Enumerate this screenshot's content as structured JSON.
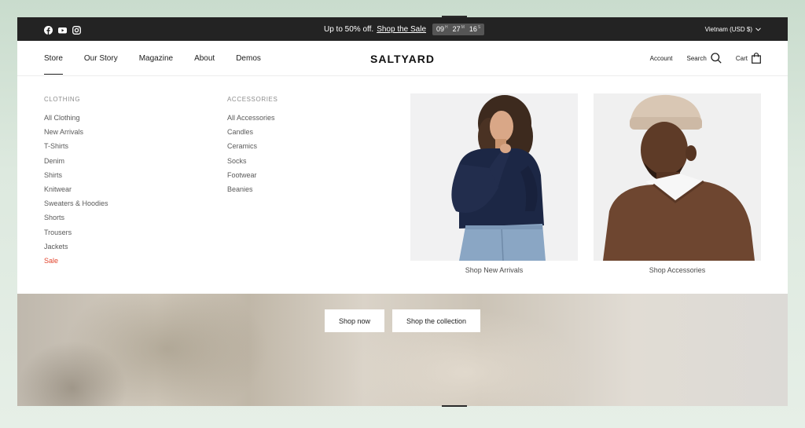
{
  "announcement": {
    "social_icons": [
      "facebook-icon",
      "youtube-icon",
      "instagram-icon"
    ],
    "promo_text": "Up to 50% off.",
    "promo_link": "Shop the Sale",
    "countdown": [
      {
        "value": "09",
        "unit": "H"
      },
      {
        "value": "27",
        "unit": "M"
      },
      {
        "value": "16",
        "unit": "S"
      }
    ],
    "locale": "Vietnam (USD $)"
  },
  "header": {
    "nav": [
      "Store",
      "Our Story",
      "Magazine",
      "About",
      "Demos"
    ],
    "active_nav": "Store",
    "logo": "SALTYARD",
    "account": "Account",
    "search": "Search",
    "cart": "Cart"
  },
  "mega_menu": {
    "clothing": {
      "heading": "CLOTHING",
      "items": [
        "All Clothing",
        "New Arrivals",
        "T-Shirts",
        "Denim",
        "Shirts",
        "Knitwear",
        "Sweaters & Hoodies",
        "Shorts",
        "Trousers",
        "Jackets",
        "Sale"
      ]
    },
    "accessories": {
      "heading": "ACCESSORIES",
      "items": [
        "All Accessories",
        "Candles",
        "Ceramics",
        "Socks",
        "Footwear",
        "Beanies"
      ]
    },
    "promos": [
      {
        "caption": "Shop New Arrivals"
      },
      {
        "caption": "Shop Accessories"
      }
    ]
  },
  "hero": {
    "buttons": [
      "Shop now",
      "Shop the collection"
    ]
  },
  "colors": {
    "topbar": "#232323",
    "sale": "#e2452e",
    "background": "#dde9df"
  }
}
